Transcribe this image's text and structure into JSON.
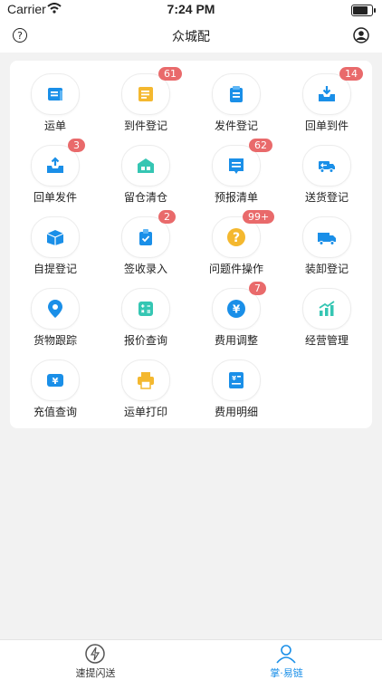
{
  "status_bar": {
    "carrier": "Carrier",
    "time": "7:24 PM"
  },
  "nav": {
    "title": "众城配"
  },
  "grid": [
    {
      "label": "运单",
      "icon": "waybill-icon",
      "badge": ""
    },
    {
      "label": "到件登记",
      "icon": "arrival-register-icon",
      "badge": "61"
    },
    {
      "label": "发件登记",
      "icon": "dispatch-register-icon",
      "badge": ""
    },
    {
      "label": "回单到件",
      "icon": "receipt-arrival-icon",
      "badge": "14"
    },
    {
      "label": "回单发件",
      "icon": "receipt-dispatch-icon",
      "badge": "3"
    },
    {
      "label": "留仓清仓",
      "icon": "warehouse-icon",
      "badge": ""
    },
    {
      "label": "预报清单",
      "icon": "forecast-list-icon",
      "badge": "62"
    },
    {
      "label": "送货登记",
      "icon": "delivery-truck-icon",
      "badge": ""
    },
    {
      "label": "自提登记",
      "icon": "pickup-box-icon",
      "badge": ""
    },
    {
      "label": "签收录入",
      "icon": "sign-receipt-icon",
      "badge": "2"
    },
    {
      "label": "问题件操作",
      "icon": "question-icon",
      "badge": "99+"
    },
    {
      "label": "装卸登记",
      "icon": "loading-truck-icon",
      "badge": ""
    },
    {
      "label": "货物跟踪",
      "icon": "location-pin-icon",
      "badge": ""
    },
    {
      "label": "报价查询",
      "icon": "calculator-icon",
      "badge": ""
    },
    {
      "label": "费用调整",
      "icon": "yen-coin-icon",
      "badge": "7"
    },
    {
      "label": "经营管理",
      "icon": "bar-chart-icon",
      "badge": ""
    },
    {
      "label": "充值查询",
      "icon": "recharge-icon",
      "badge": ""
    },
    {
      "label": "运单打印",
      "icon": "printer-icon",
      "badge": ""
    },
    {
      "label": "费用明细",
      "icon": "fee-detail-icon",
      "badge": ""
    }
  ],
  "tabs": [
    {
      "label": "速提闪送",
      "icon": "lightning-icon",
      "active": false
    },
    {
      "label": "掌·易链",
      "icon": "user-icon",
      "active": true
    }
  ],
  "colors": {
    "primary": "#1a8fe8",
    "badge": "#e96a6b",
    "yellow": "#f4b82f",
    "teal": "#35c6b3"
  }
}
